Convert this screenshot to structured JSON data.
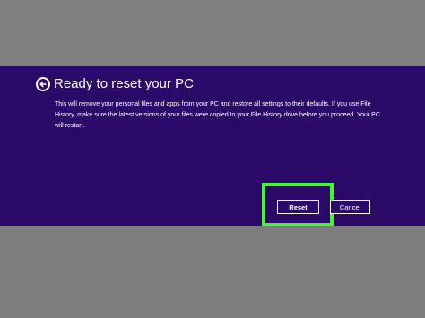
{
  "dialog": {
    "title": "Ready to reset your PC",
    "description": "This will remove your personal files and apps from your PC and restore all settings to their defaults. If you use File History, make sure the latest versions of your files were copied to your File History drive before you proceed. Your PC will restart.",
    "back_icon": "back-arrow-icon",
    "buttons": {
      "reset_label": "Reset",
      "cancel_label": "Cancel"
    }
  },
  "colors": {
    "dialog_background": "#2a0968",
    "page_background": "#7d7d7d",
    "highlight": "#39ff1e",
    "text": "#ffffff"
  }
}
